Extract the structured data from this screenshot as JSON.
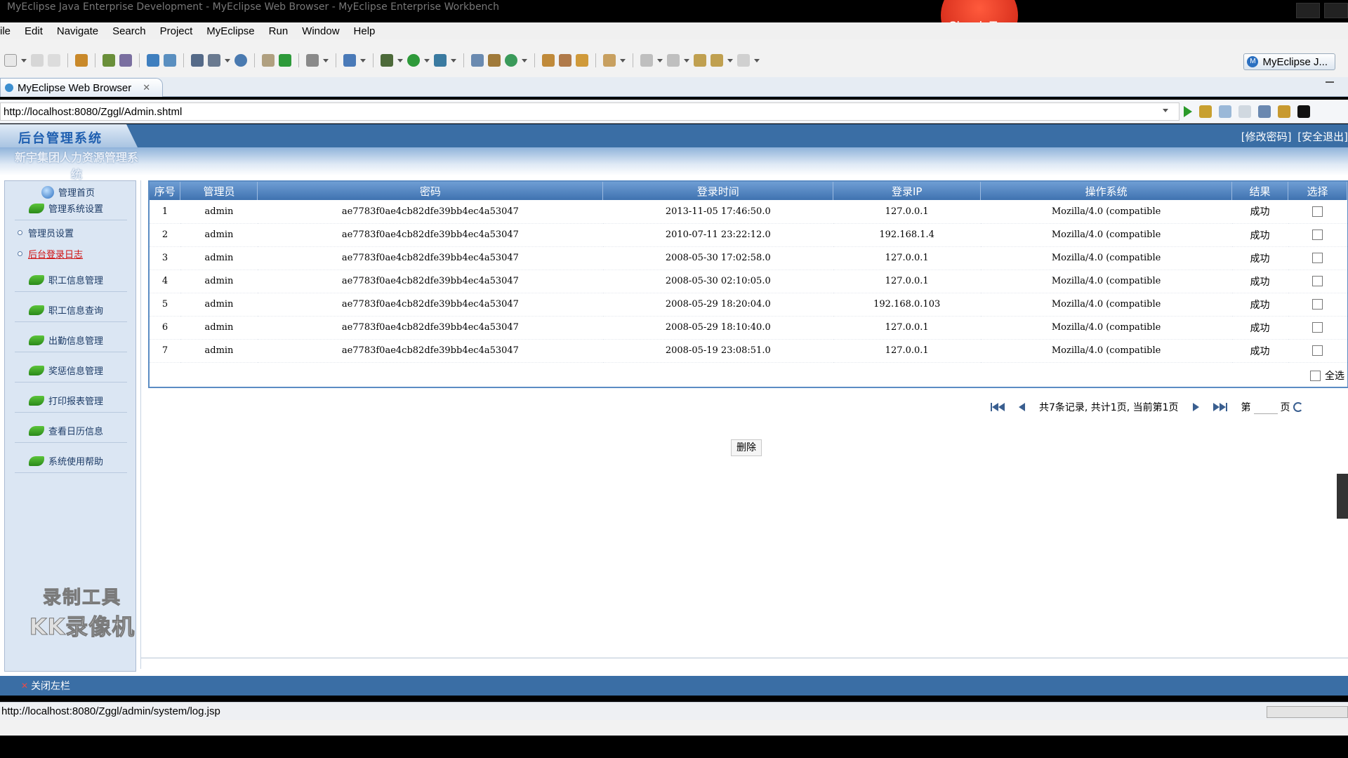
{
  "window": {
    "title": "MyEclipse Java Enterprise Development - MyEclipse Web Browser - MyEclipse Enterprise Workbench",
    "overlay_badge": "SimpleTap"
  },
  "menu": [
    "ile",
    "Edit",
    "Navigate",
    "Search",
    "Project",
    "MyEclipse",
    "Run",
    "Window",
    "Help"
  ],
  "perspective": {
    "label": "MyEclipse J...",
    "icon": "myeclipse-perspective-icon"
  },
  "editor_tab": {
    "label": "MyEclipse Web Browser",
    "close": "✕"
  },
  "address": {
    "url": "http://localhost:8080/Zggl/Admin.shtml"
  },
  "app": {
    "logo": "后台管理系统",
    "system_name": "新宇集团人力资源管理系统",
    "top_links": [
      "[修改密码]",
      "[安全退出]"
    ],
    "home_label": "管理首页",
    "nav": [
      {
        "label": "管理系统设置"
      },
      {
        "label": "职工信息管理"
      },
      {
        "label": "职工信息查询"
      },
      {
        "label": "出勤信息管理"
      },
      {
        "label": "奖惩信息管理"
      },
      {
        "label": "打印报表管理"
      },
      {
        "label": "查看日历信息"
      },
      {
        "label": "系统使用帮助"
      }
    ],
    "sub_nav": [
      {
        "label": "管理员设置",
        "active": false
      },
      {
        "label": "后台登录日志",
        "active": true
      }
    ],
    "watermark": [
      "录制工具",
      "KK录像机"
    ],
    "close_sidebar": "关闭左栏"
  },
  "log_table": {
    "headers": [
      "序号",
      "管理员",
      "密码",
      "登录时间",
      "登录IP",
      "操作系统",
      "结果",
      "选择"
    ],
    "rows": [
      [
        "1",
        "admin",
        "ae7783f0ae4cb82dfe39bb4ec4a53047",
        "2013-11-05 17:46:50.0",
        "127.0.0.1",
        "Mozilla/4.0 (compatible",
        "成功"
      ],
      [
        "2",
        "admin",
        "ae7783f0ae4cb82dfe39bb4ec4a53047",
        "2010-07-11 23:22:12.0",
        "192.168.1.4",
        "Mozilla/4.0 (compatible",
        "成功"
      ],
      [
        "3",
        "admin",
        "ae7783f0ae4cb82dfe39bb4ec4a53047",
        "2008-05-30 17:02:58.0",
        "127.0.0.1",
        "Mozilla/4.0 (compatible",
        "成功"
      ],
      [
        "4",
        "admin",
        "ae7783f0ae4cb82dfe39bb4ec4a53047",
        "2008-05-30 02:10:05.0",
        "127.0.0.1",
        "Mozilla/4.0 (compatible",
        "成功"
      ],
      [
        "5",
        "admin",
        "ae7783f0ae4cb82dfe39bb4ec4a53047",
        "2008-05-29 18:20:04.0",
        "192.168.0.103",
        "Mozilla/4.0 (compatible",
        "成功"
      ],
      [
        "6",
        "admin",
        "ae7783f0ae4cb82dfe39bb4ec4a53047",
        "2008-05-29 18:10:40.0",
        "127.0.0.1",
        "Mozilla/4.0 (compatible",
        "成功"
      ],
      [
        "7",
        "admin",
        "ae7783f0ae4cb82dfe39bb4ec4a53047",
        "2008-05-19 23:08:51.0",
        "127.0.0.1",
        "Mozilla/4.0 (compatible",
        "成功"
      ]
    ],
    "select_all": "全选"
  },
  "pager": {
    "summary": "共7条记录, 共计1页, 当前第1页",
    "page_prefix": "第",
    "page_suffix": "页"
  },
  "actions": {
    "delete": "删除"
  },
  "status": {
    "url": "http://localhost:8080/Zggl/admin/system/log.jsp"
  },
  "colors": {
    "header_blue": "#3a6ea5",
    "table_header": "#4f82be",
    "active_link": "#d01010"
  }
}
